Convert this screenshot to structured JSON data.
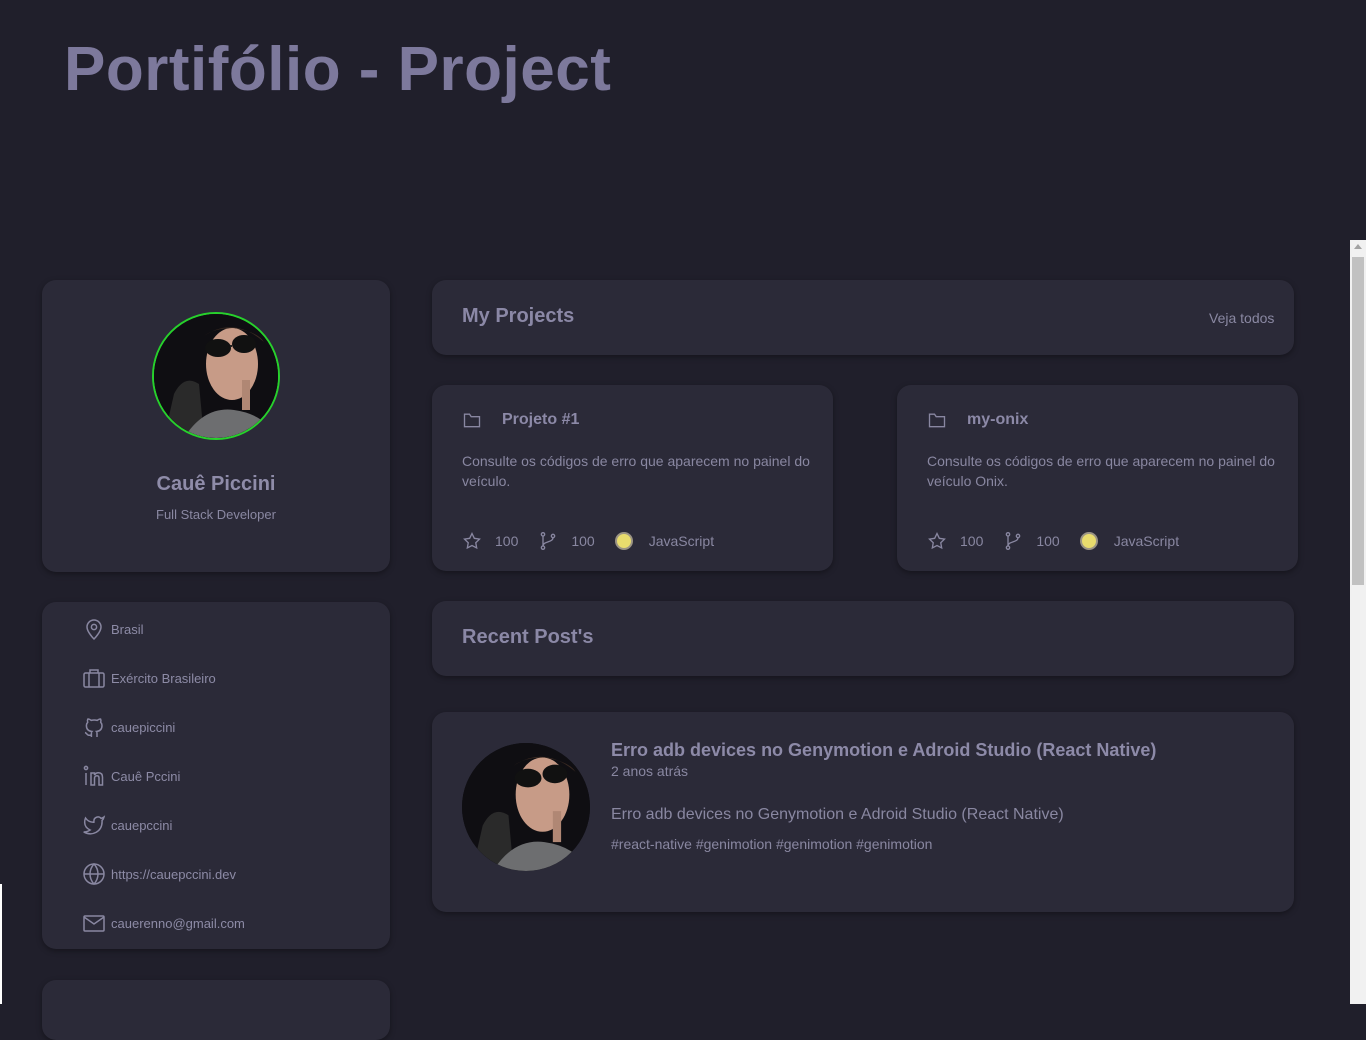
{
  "header": {
    "title": "Portifólio - Project"
  },
  "profile": {
    "name": "Cauê Piccini",
    "role": "Full Stack Developer"
  },
  "info": {
    "location": "Brasil",
    "company": "Exército Brasileiro",
    "github": "cauepiccini",
    "linkedin": "Cauê Pccini",
    "twitter": "cauepccini",
    "website": "https://cauepccini.dev",
    "email": "cauerenno@gmail.com"
  },
  "projects_section": {
    "title": "My Projects",
    "see_all": "Veja todos"
  },
  "projects": [
    {
      "name": "Projeto #1",
      "description": "Consulte os códigos de erro que aparecem no painel do veículo.",
      "stars": "100",
      "forks": "100",
      "language": "JavaScript"
    },
    {
      "name": "my-onix",
      "description": "Consulte os códigos de erro que aparecem no painel do veículo Onix.",
      "stars": "100",
      "forks": "100",
      "language": "JavaScript"
    }
  ],
  "posts_section": {
    "title": "Recent Post's"
  },
  "post": {
    "title": "Erro adb devices no Genymotion e Adroid Studio (React Native)",
    "time": "2 anos atrás",
    "description": "Erro adb devices no Genymotion e Adroid Studio (React Native)",
    "tags": "#react-native #genimotion #genimotion #genimotion"
  },
  "colors": {
    "background": "#201f2b",
    "card": "#2b2a38",
    "text": "#8c8aa6",
    "avatar_ring": "#27d12c",
    "language_dot": "#e9dc6d"
  },
  "icons": [
    "folder-icon",
    "star-icon",
    "fork-icon",
    "location-icon",
    "briefcase-icon",
    "github-icon",
    "linkedin-icon",
    "twitter-icon",
    "globe-icon",
    "mail-icon"
  ]
}
